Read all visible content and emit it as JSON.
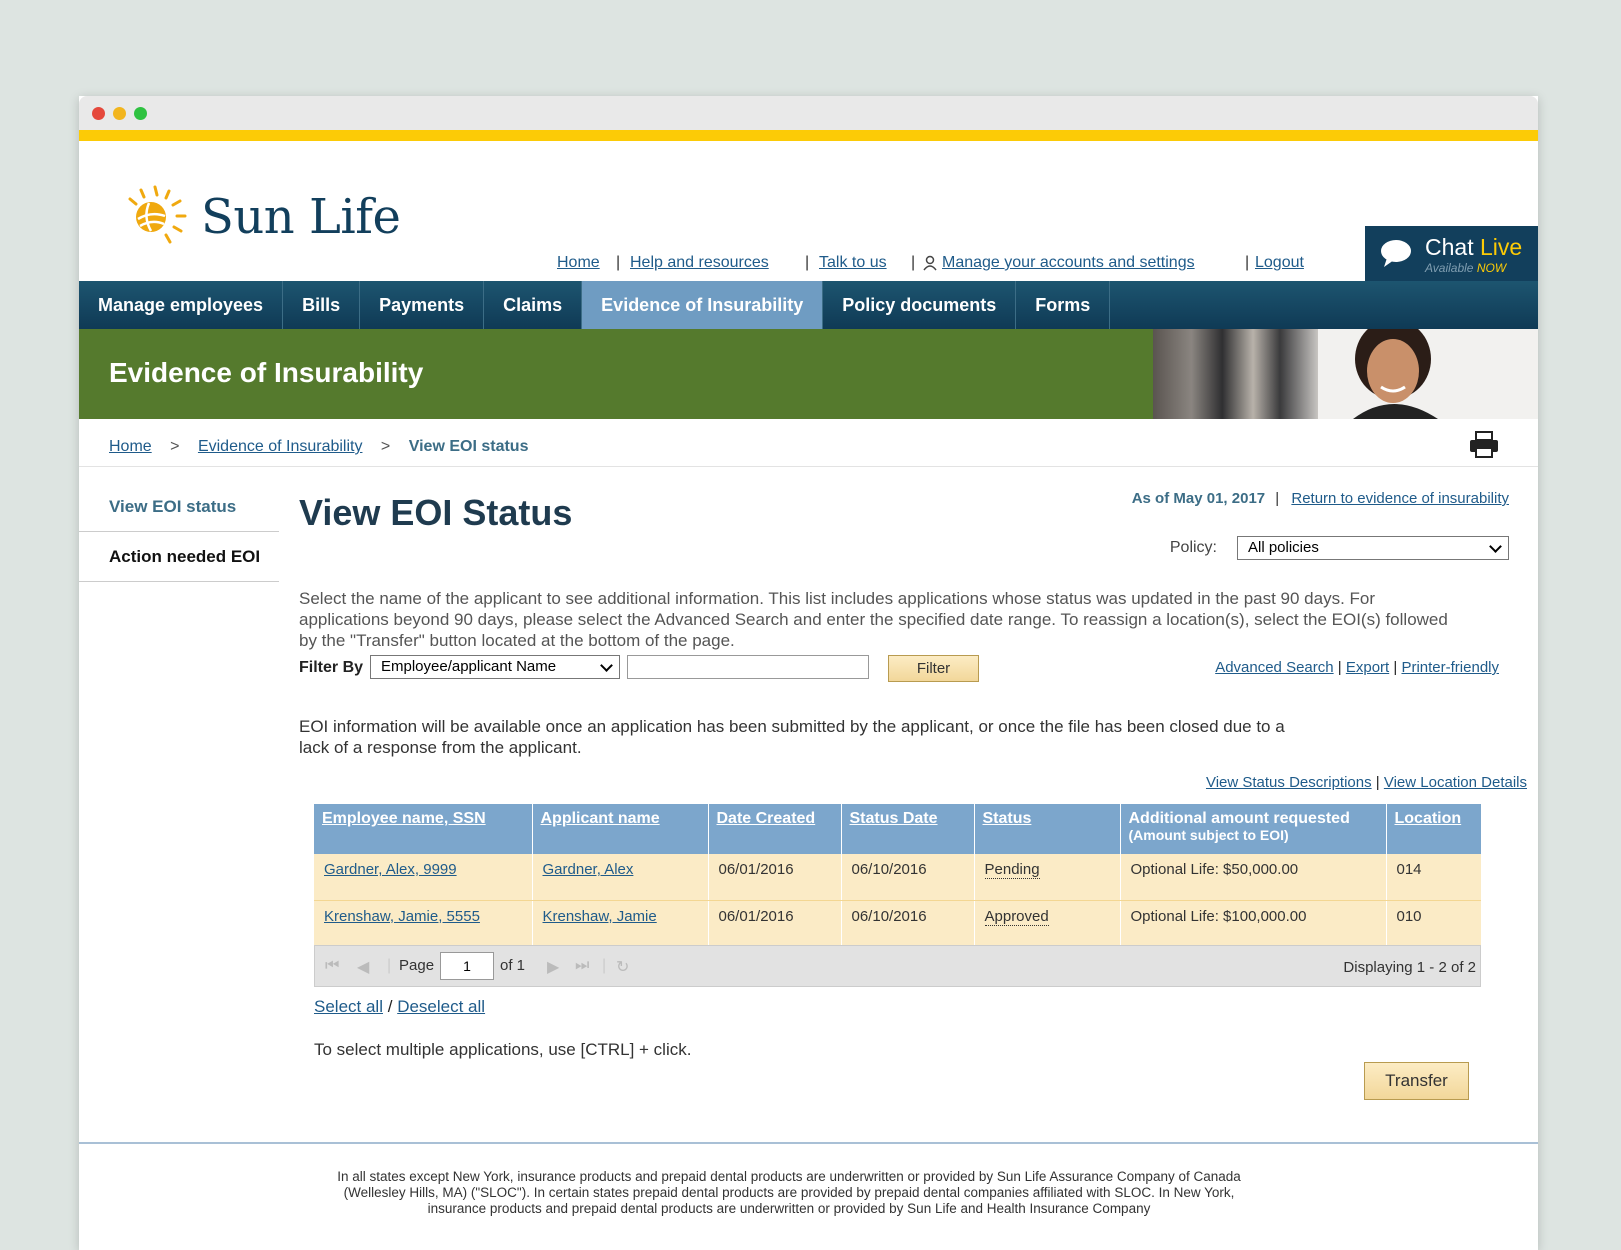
{
  "brand": {
    "name": "Sun Life",
    "accent": "#fccb06",
    "navy": "#123f5c",
    "green": "#557a2d"
  },
  "utility_nav": {
    "home": "Home",
    "help": "Help and resources",
    "talk": "Talk to us",
    "manage": "Manage your accounts and settings",
    "logout": "Logout",
    "sep": "|"
  },
  "chat": {
    "title_a": "Chat ",
    "title_b": "Live",
    "sub_a": "Available ",
    "sub_b": "NOW"
  },
  "main_nav": [
    {
      "label": "Manage employees"
    },
    {
      "label": "Bills"
    },
    {
      "label": "Payments"
    },
    {
      "label": "Claims"
    },
    {
      "label": "Evidence of Insurability",
      "active": true
    },
    {
      "label": "Policy documents"
    },
    {
      "label": "Forms"
    }
  ],
  "banner": {
    "title": "Evidence of Insurability"
  },
  "breadcrumb": {
    "home": "Home",
    "eoi": "Evidence of Insurability",
    "current": "View EOI status",
    "sep": ">"
  },
  "sidebar": [
    {
      "label": "View EOI status"
    },
    {
      "label": "Action needed EOI"
    }
  ],
  "page": {
    "title": "View EOI Status",
    "as_of": "As of May 01, 2017",
    "return_link": "Return to evidence of insurability",
    "policy_label": "Policy:",
    "policy_value": "All policies",
    "intro": "Select the name of the applicant to see additional information. This list includes applications whose status was updated in the past 90 days. For applications beyond 90 days, please select the Advanced Search and enter the specified date range. To reassign a location(s), select the EOI(s) followed by the \"Transfer\" button located at the bottom of the page.",
    "filter_label": "Filter By",
    "filter_value": "Employee/applicant Name",
    "filter_input_value": "",
    "filter_button": "Filter",
    "advanced_search": "Advanced Search",
    "export": "Export",
    "printer_friendly": "Printer-friendly",
    "info": "EOI information will be available once an application has been submitted by the applicant, or once the file has been closed due to a lack of a response from the applicant.",
    "view_status": "View Status Descriptions",
    "view_location": "View Location Details"
  },
  "table": {
    "headers": [
      "Employee name, SSN",
      "Applicant name",
      "Date Created",
      "Status Date",
      "Status",
      "Additional amount requested",
      "Location"
    ],
    "header_sub": "(Amount subject to EOI)",
    "rows": [
      [
        "Gardner, Alex, 9999",
        "Gardner, Alex",
        "06/01/2016",
        "06/10/2016",
        "Pending",
        "Optional Life: $50,000.00",
        "014"
      ],
      [
        "Krenshaw, Jamie, 5555",
        "Krenshaw, Jamie",
        "06/01/2016",
        "06/10/2016",
        "Approved",
        "Optional Life: $100,000.00",
        "010"
      ]
    ]
  },
  "pager": {
    "page_label": "Page",
    "page_value": "1",
    "of": "of 1",
    "display": "Displaying 1 - 2 of 2"
  },
  "actions": {
    "select_all": "Select all",
    "slash": "/",
    "deselect_all": "Deselect all",
    "tip": "To select multiple applications, use [CTRL] + click.",
    "transfer": "Transfer"
  },
  "footer": "In all states except New York, insurance products and prepaid dental products are underwritten or provided by Sun Life Assurance Company of Canada (Wellesley Hills, MA) (\"SLOC\"). In certain states prepaid dental products are provided by prepaid dental companies affiliated with SLOC. In New York, insurance products and prepaid dental products are underwritten or provided by Sun Life and Health Insurance Company"
}
